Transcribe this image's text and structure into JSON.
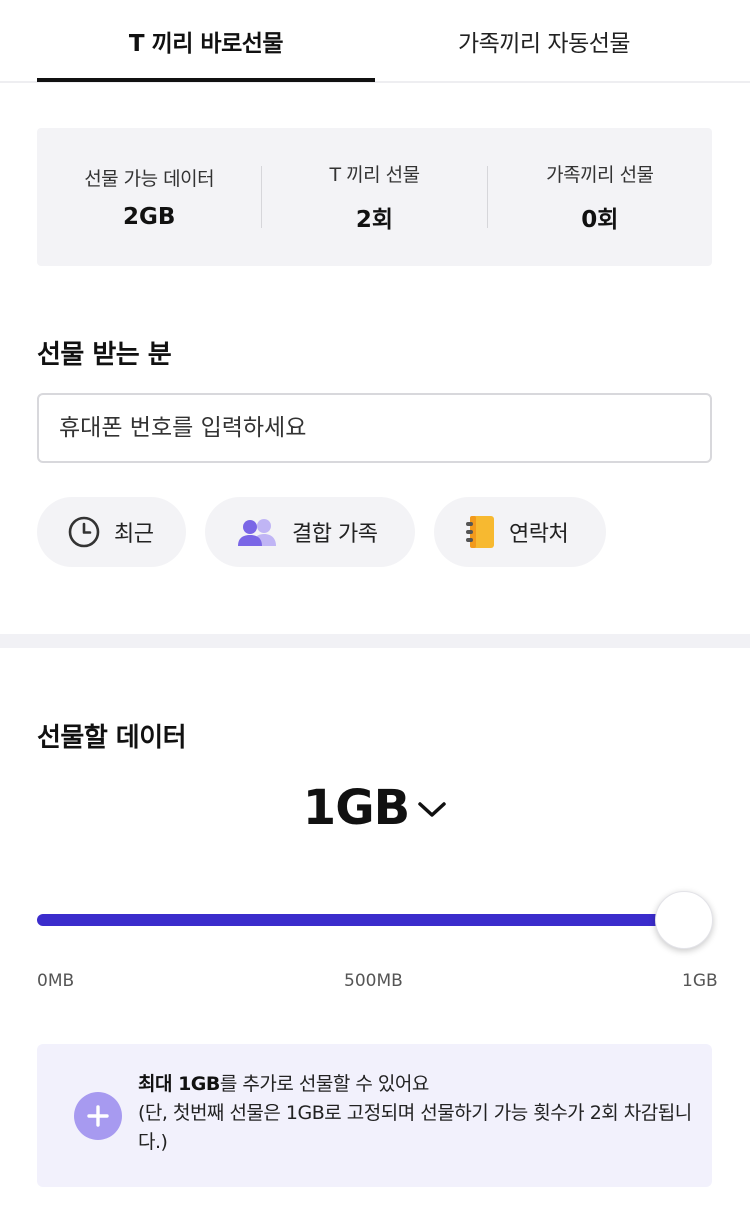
{
  "tabs": [
    {
      "label": "T 끼리 바로선물",
      "active": true
    },
    {
      "label": "가족끼리 자동선물",
      "active": false
    }
  ],
  "summary": [
    {
      "label": "선물 가능 데이터",
      "value": "2GB"
    },
    {
      "label": "T 끼리 선물",
      "value": "2회"
    },
    {
      "label": "가족끼리 선물",
      "value": "0회"
    }
  ],
  "recipient": {
    "title": "선물 받는 분",
    "placeholder": "휴대폰 번호를 입력하세요",
    "chips": [
      {
        "label": "최근",
        "icon": "clock-icon"
      },
      {
        "label": "결합 가족",
        "icon": "people-icon"
      },
      {
        "label": "연락처",
        "icon": "address-book-icon"
      }
    ]
  },
  "data_gift": {
    "title": "선물할 데이터",
    "amount": "1GB",
    "slider": {
      "min_label": "0MB",
      "mid_label": "500MB",
      "max_label": "1GB",
      "value_fraction": 1.0
    },
    "notice": {
      "line1_bold": "최대 1GB",
      "line1_rest": "를 추가로 선물할 수 있어요",
      "line2": "(단, 첫번째 선물은 1GB로 고정되며 선물하기 가능 횟수가 2회 차감됩니다.)"
    }
  },
  "colors": {
    "accent": "#3b2ccc",
    "plus_circle": "#a79af0",
    "notice_bg": "#f2f1fc",
    "summary_bg": "#f3f3f6",
    "chip_bg": "#f3f3f6"
  }
}
